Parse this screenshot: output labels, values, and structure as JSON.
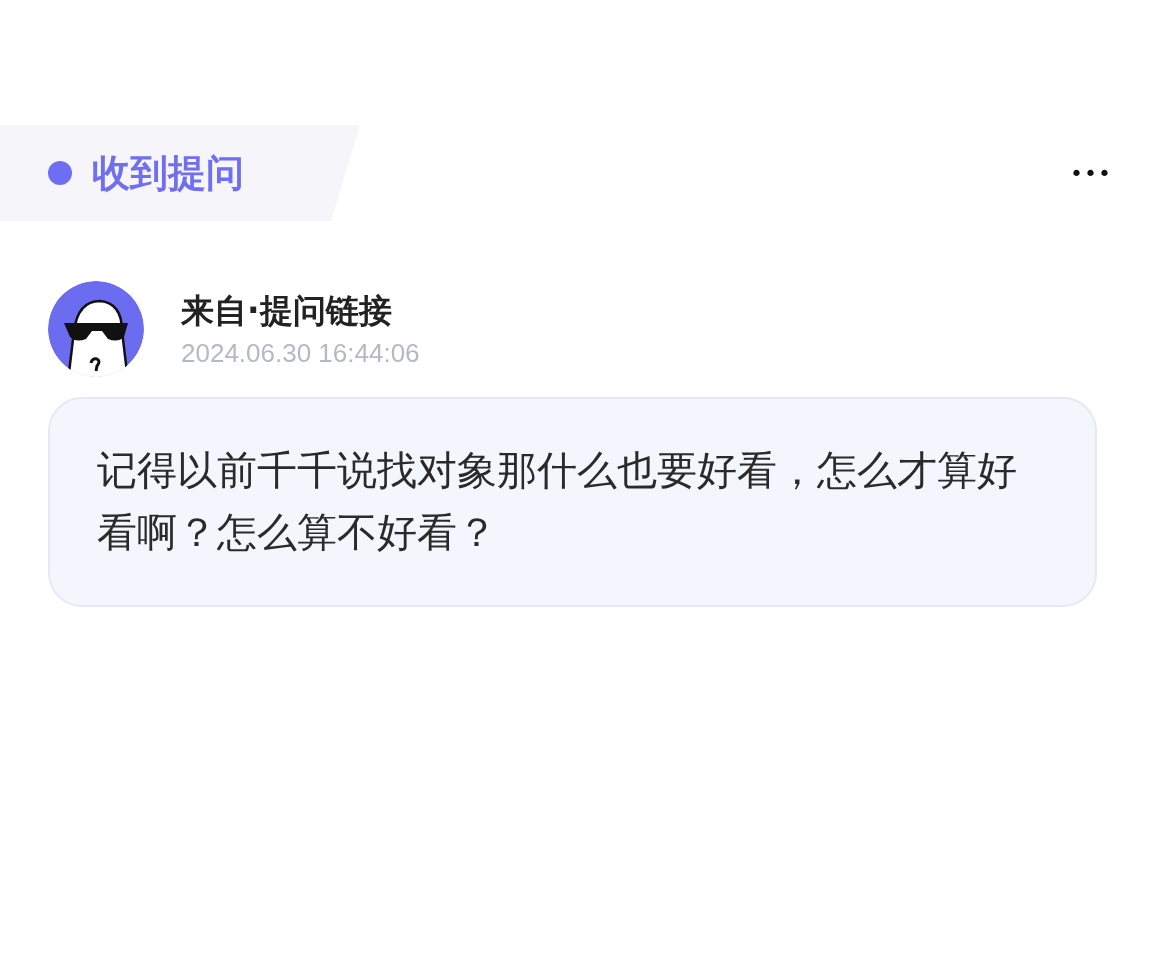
{
  "header": {
    "title": "收到提问",
    "more": "•••"
  },
  "question": {
    "sender": "来自·提问链接",
    "time": "2024.06.30 16:44:06",
    "text": "记得以前千千说找对象那什么也要好看，怎么才算好看啊？怎么算不好看？"
  }
}
